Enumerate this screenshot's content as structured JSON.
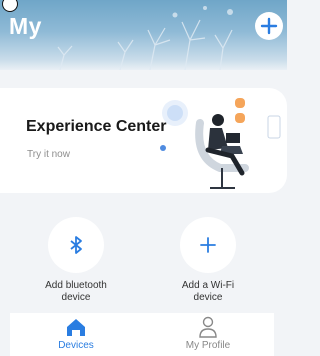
{
  "header": {
    "title": "My"
  },
  "banner": {
    "title": "Experience Center",
    "subtitle": "Try it now"
  },
  "actions": [
    {
      "label_line1": "Add bluetooth",
      "label_line2": "device",
      "icon": "bluetooth-icon"
    },
    {
      "label_line1": "Add a Wi-Fi",
      "label_line2": "device",
      "icon": "plus-icon"
    }
  ],
  "tabs": [
    {
      "label": "Devices",
      "icon": "home-icon",
      "active": true
    },
    {
      "label": "My Profile",
      "icon": "person-icon",
      "active": false
    }
  ],
  "colors": {
    "accent": "#2a7de1",
    "inactive": "#888888"
  }
}
